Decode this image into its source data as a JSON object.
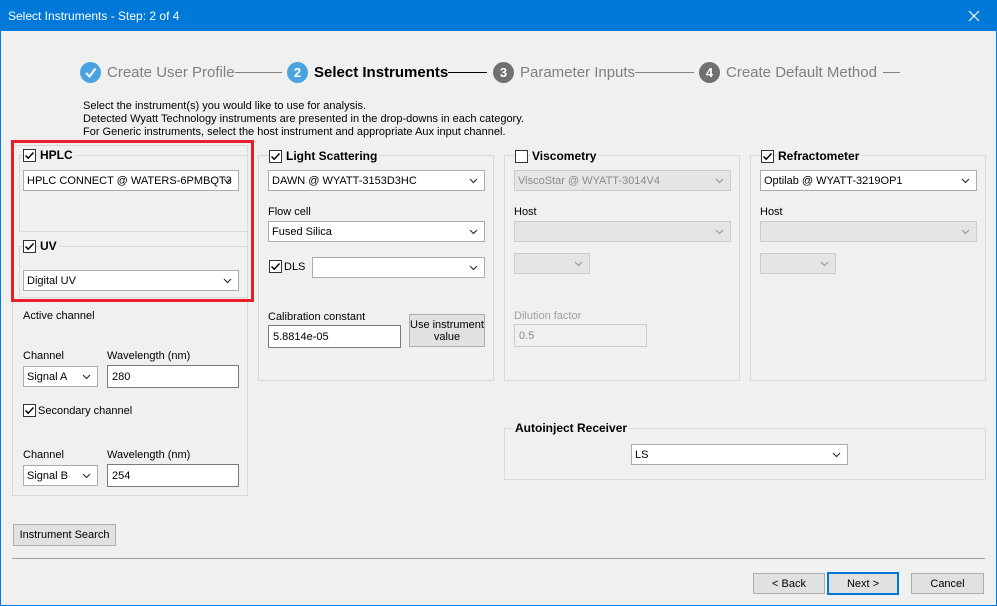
{
  "window": {
    "title": "Select Instruments - Step: 2 of 4",
    "close_glyph": "✕"
  },
  "steps": [
    {
      "num": "✓",
      "label": "Create User Profile",
      "state": "done",
      "color": "#4aa3df"
    },
    {
      "num": "2",
      "label": "Select Instruments",
      "state": "active",
      "color": "#4aa3df"
    },
    {
      "num": "3",
      "label": "Parameter Inputs",
      "state": "pending",
      "color": "#707070"
    },
    {
      "num": "4",
      "label": "Create Default Method",
      "state": "pending",
      "color": "#707070"
    }
  ],
  "intro": [
    "Select the instrument(s) you would like to use for analysis.",
    "Detected Wyatt Technology instruments are presented in the drop-downs in each category.",
    "For Generic instruments, select the host instrument and appropriate Aux input channel."
  ],
  "hplc": {
    "label": "HPLC",
    "checked": true,
    "selected": "HPLC CONNECT @ WATERS-6PMBQT3"
  },
  "uv": {
    "label": "UV",
    "checked": true,
    "selected": "Digital UV",
    "active_channel_label": "Active channel",
    "channel_label": "Channel",
    "wavelength_label": "Wavelength (nm)",
    "channel_a": "Signal A",
    "wavelength_a": "280",
    "secondary_label": "Secondary channel",
    "secondary_checked": true,
    "channel_label_2": "Channel",
    "wavelength_label_2": "Wavelength (nm)",
    "channel_b": "Signal B",
    "wavelength_b": "254"
  },
  "light_scattering": {
    "label": "Light  Scattering",
    "checked": true,
    "selected": "DAWN @ WYATT-3153D3HC",
    "flow_cell_label": "Flow cell",
    "flow_cell": "Fused Silica",
    "dls_label": "DLS",
    "dls_checked": true,
    "dls_selected": "",
    "calibration_label": "Calibration constant",
    "calibration_value": "5.8814e-05",
    "use_instrument_value": "Use instrument value"
  },
  "viscometry": {
    "label": "Viscometry",
    "checked": false,
    "selected": "ViscoStar @ WYATT-3014V4",
    "host_label": "Host",
    "host_selected": "",
    "aux_selected": "",
    "dilution_label": "Dilution factor",
    "dilution_value": "0.5"
  },
  "refractometer": {
    "label": "Refractometer",
    "checked": true,
    "selected": "Optilab @ WYATT-3219OP1",
    "host_label": "Host",
    "host_selected": "",
    "aux_selected": ""
  },
  "autoinject": {
    "label": "Autoinject Receiver",
    "selected": "LS"
  },
  "buttons": {
    "instrument_search": "Instrument Search",
    "back": "< Back",
    "next": "Next >",
    "cancel": "Cancel"
  },
  "colors": {
    "titlebar": "#0078d7",
    "highlight": "#e8202a",
    "step_active": "#4aa3df"
  }
}
